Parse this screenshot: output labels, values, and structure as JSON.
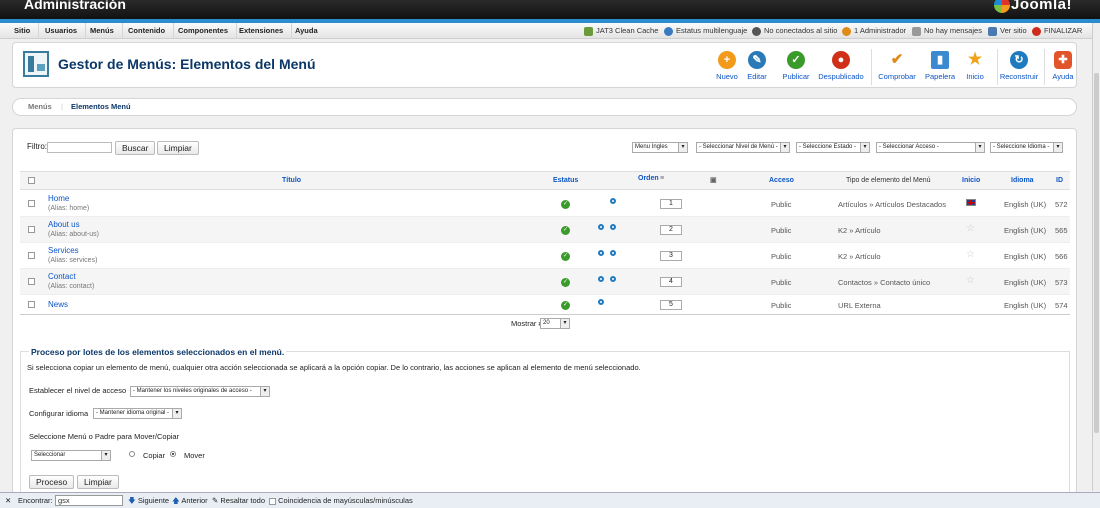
{
  "header": {
    "title": "Administración",
    "logo": "Joomla!"
  },
  "menubar": {
    "items": [
      "Sitio",
      "Usuarios",
      "Menús",
      "Contenido",
      "Componentes",
      "Extensiones",
      "Ayuda"
    ],
    "status": {
      "jat3": "JAT3 Clean Cache",
      "multilang": "Estatus multilenguaje",
      "site_visitors": "No conectados al sitio",
      "admins": "1 Administrador",
      "messages": "No hay mensajes",
      "view_site": "Ver sitio",
      "logout": "FINALIZAR"
    }
  },
  "toolbar": {
    "page_title": "Gestor de Menús: Elementos del Menú",
    "buttons": {
      "new": "Nuevo",
      "edit": "Editar",
      "publish": "Publicar",
      "unpublish": "Despublicado",
      "check": "Comprobar",
      "trash": "Papelera",
      "home": "Inicio",
      "rebuild": "Reconstruir",
      "help": "Ayuda"
    }
  },
  "submenu": {
    "menus": "Menús",
    "items": "Elementos Menú"
  },
  "filters": {
    "label": "Filtro:",
    "search_value": "",
    "search_button": "Buscar",
    "clear_button": "Limpiar",
    "menu_select": "Menu Ingles",
    "level_select": "- Seleccionar Nivel de Menú -",
    "state_select": "- Seleccione Estado -",
    "access_select": "- Seleccionar Acceso -",
    "language_select": "- Seleccione Idioma -"
  },
  "table": {
    "headers": {
      "title": "Título",
      "status": "Estatus",
      "order": "Orden",
      "access": "Acceso",
      "type": "Tipo de elemento del Menú",
      "home": "Inicio",
      "language": "Idioma",
      "id": "ID"
    },
    "rows": [
      {
        "title": "Home",
        "alias": "(Alias: home)",
        "order": "1",
        "access": "Public",
        "type": "Artículos » Artículos Destacados",
        "language": "English (UK)",
        "id": "572",
        "home": true,
        "arrows": 1
      },
      {
        "title": "About us",
        "alias": "(Alias: about-us)",
        "order": "2",
        "access": "Public",
        "type": "K2 » Artículo",
        "language": "English (UK)",
        "id": "565",
        "home": false,
        "arrows": 2
      },
      {
        "title": "Services",
        "alias": "(Alias: services)",
        "order": "3",
        "access": "Public",
        "type": "K2 » Artículo",
        "language": "English (UK)",
        "id": "566",
        "home": false,
        "arrows": 2
      },
      {
        "title": "Contact",
        "alias": "(Alias: contact)",
        "order": "4",
        "access": "Public",
        "type": "Contactos » Contacto único",
        "language": "English (UK)",
        "id": "573",
        "home": false,
        "arrows": 2
      },
      {
        "title": "News",
        "alias": "",
        "order": "5",
        "access": "Public",
        "type": "URL Externa",
        "language": "English (UK)",
        "id": "574",
        "home": false,
        "arrows": 1
      }
    ],
    "show_label": "Mostrar #",
    "show_value": "20"
  },
  "batch": {
    "title": "Proceso por lotes de los elementos seleccionados en el menú.",
    "description": "Si selecciona copiar un elemento de menú, cualquier otra acción seleccionada se aplicará a la opción copiar. De lo contrario, las acciones se aplican al elemento de menú seleccionado.",
    "access_label": "Establecer el nivel de acceso",
    "access_select": "- Mantener los niveles originales de acceso -",
    "lang_label": "Configurar idioma",
    "lang_select": "- Mantener idioma original -",
    "menu_label": "Seleccione Menú o Padre para Mover/Copiar",
    "menu_select": "Seleccionar",
    "copy": "Copiar",
    "move": "Mover",
    "process_button": "Proceso",
    "clear_button": "Limpiar"
  },
  "findbar": {
    "label": "Encontrar:",
    "value": "gsx",
    "next": "Siguiente",
    "prev": "Anterior",
    "highlight": "Resaltar todo",
    "match_case": "Coincidencia de mayúsculas/minúsculas"
  }
}
